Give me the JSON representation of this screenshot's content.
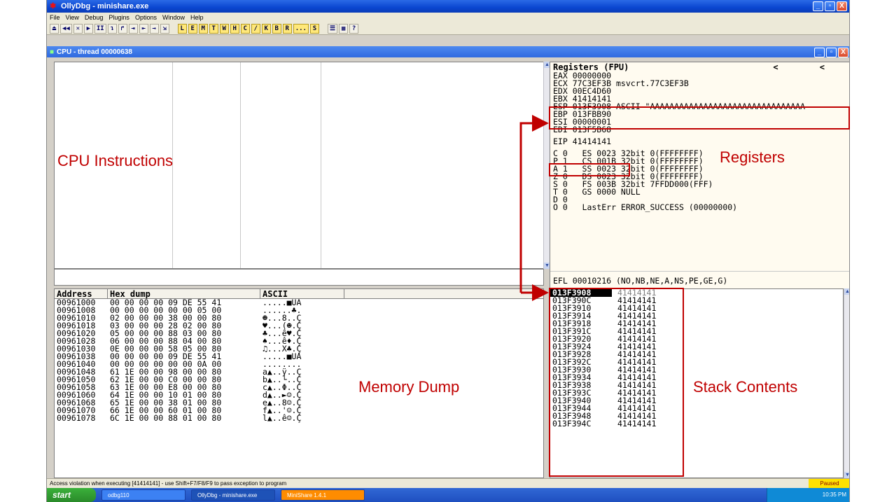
{
  "window": {
    "title": "OllyDbg - minishare.exe",
    "menu": [
      "File",
      "View",
      "Debug",
      "Plugins",
      "Options",
      "Window",
      "Help"
    ],
    "toolbar_buttons": [
      "⏏",
      "◀◀",
      "✕",
      "▶",
      "II",
      "↴",
      "↱",
      "⇥",
      "⇤",
      "→",
      "⇲",
      "L",
      "E",
      "M",
      "T",
      "W",
      "H",
      "C",
      "/",
      "K",
      "B",
      "R",
      "...",
      "S",
      "☰",
      "▦",
      "?"
    ],
    "minimize": "_",
    "maximize": "▫",
    "close": "X"
  },
  "cpu_window": {
    "title": "CPU - thread 00000638"
  },
  "annotations": {
    "cpu_instructions": "CPU Instructions",
    "registers": "Registers",
    "memory_dump": "Memory Dump",
    "stack_contents": "Stack Contents"
  },
  "registers": {
    "header": "Registers (FPU)",
    "arrows": "<  <",
    "general": [
      "EAX 00000000",
      "ECX 77C3EF3B msvcrt.77C3EF3B",
      "EDX 00EC4D60",
      "EBX 41414141",
      "ESP 013F3908 ASCII \"AAAAAAAAAAAAAAAAAAAAAAAAAAAAAAAA",
      "EBP 013FBB90",
      "ESI 00000001",
      "EDI 013F5B68"
    ],
    "eip": "EIP 41414141",
    "flags": [
      "C 0   ES 0023 32bit 0(FFFFFFFF)",
      "P 1   CS 001B 32bit 0(FFFFFFFF)",
      "A 1   SS 0023 32bit 0(FFFFFFFF)",
      "Z 0   DS 0023 32bit 0(FFFFFFFF)",
      "S 0   FS 003B 32bit 7FFDD000(FFF)",
      "T 0   GS 0000 NULL",
      "D 0",
      "O 0   LastErr ERROR_SUCCESS (00000000)"
    ],
    "efl": "EFL 00010216 (NO,NB,NE,A,NS,PE,GE,G)"
  },
  "memory": {
    "columns": [
      "Address",
      "Hex dump",
      "ASCII"
    ],
    "rows": [
      {
        "addr": "00961000",
        "hex": "00 00 00 00 09 DE 55 41",
        "ascii": ".....■UA"
      },
      {
        "addr": "00961008",
        "hex": "00 00 00 00 00 00 05 00",
        "ascii": "......♣."
      },
      {
        "addr": "00961010",
        "hex": "02 00 00 00 38 00 00 80",
        "ascii": "☻...8..Ç"
      },
      {
        "addr": "00961018",
        "hex": "03 00 00 00 28 02 00 80",
        "ascii": "♥...(☻.Ç"
      },
      {
        "addr": "00961020",
        "hex": "05 00 00 00 88 03 00 80",
        "ascii": "♣...ê♥.Ç"
      },
      {
        "addr": "00961028",
        "hex": "06 00 00 00 88 04 00 80",
        "ascii": "♠...ê♦.Ç"
      },
      {
        "addr": "00961030",
        "hex": "0E 00 00 00 58 05 00 80",
        "ascii": "♫...X♣.Ç"
      },
      {
        "addr": "00961038",
        "hex": "00 00 00 00 09 DE 55 41",
        "ascii": ".....■UA"
      },
      {
        "addr": "00961040",
        "hex": "00 00 00 00 00 00 0A 00",
        "ascii": "........"
      },
      {
        "addr": "00961048",
        "hex": "61 1E 00 00 98 00 00 80",
        "ascii": "a▲..ÿ..Ç"
      },
      {
        "addr": "00961050",
        "hex": "62 1E 00 00 C0 00 00 80",
        "ascii": "b▲..└..Ç"
      },
      {
        "addr": "00961058",
        "hex": "63 1E 00 00 E8 00 00 80",
        "ascii": "c▲..Φ..Ç"
      },
      {
        "addr": "00961060",
        "hex": "64 1E 00 00 10 01 00 80",
        "ascii": "d▲..►☺.Ç"
      },
      {
        "addr": "00961068",
        "hex": "65 1E 00 00 38 01 00 80",
        "ascii": "e▲..8☺.Ç"
      },
      {
        "addr": "00961070",
        "hex": "66 1E 00 00 60 01 00 80",
        "ascii": "f▲..'☺.Ç"
      },
      {
        "addr": "00961078",
        "hex": "6C 1E 00 00 88 01 00 80",
        "ascii": "l▲..ê☺.Ç"
      }
    ]
  },
  "stack": {
    "rows": [
      {
        "addr": "013F3908",
        "val": "41414141"
      },
      {
        "addr": "013F390C",
        "val": "41414141"
      },
      {
        "addr": "013F3910",
        "val": "41414141"
      },
      {
        "addr": "013F3914",
        "val": "41414141"
      },
      {
        "addr": "013F3918",
        "val": "41414141"
      },
      {
        "addr": "013F391C",
        "val": "41414141"
      },
      {
        "addr": "013F3920",
        "val": "41414141"
      },
      {
        "addr": "013F3924",
        "val": "41414141"
      },
      {
        "addr": "013F3928",
        "val": "41414141"
      },
      {
        "addr": "013F392C",
        "val": "41414141"
      },
      {
        "addr": "013F3930",
        "val": "41414141"
      },
      {
        "addr": "013F3934",
        "val": "41414141"
      },
      {
        "addr": "013F3938",
        "val": "41414141"
      },
      {
        "addr": "013F393C",
        "val": "41414141"
      },
      {
        "addr": "013F3940",
        "val": "41414141"
      },
      {
        "addr": "013F3944",
        "val": "41414141"
      },
      {
        "addr": "013F3948",
        "val": "41414141"
      },
      {
        "addr": "013F394C",
        "val": "41414141"
      }
    ]
  },
  "status": {
    "message": "Access violation when executing [41414141] - use Shift+F7/F8/F9 to pass exception to program",
    "state": "Paused"
  },
  "taskbar": {
    "start": "start",
    "tasks": [
      "odbg110",
      "OllyDbg - minishare.exe",
      "MiniShare 1.4.1"
    ],
    "clock": "10:35 PM"
  }
}
